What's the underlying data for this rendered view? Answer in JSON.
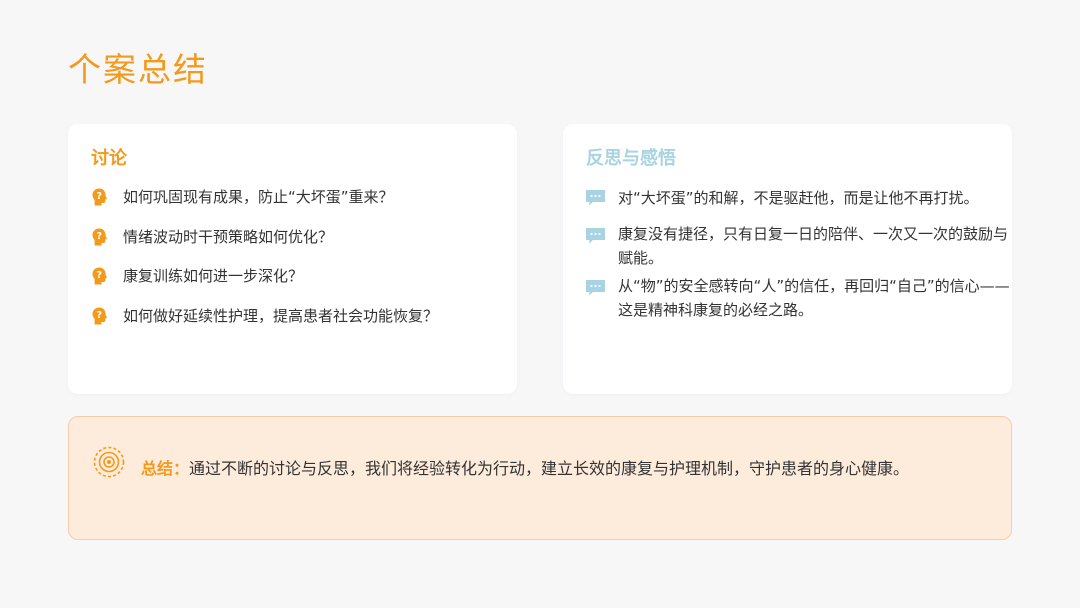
{
  "page": {
    "title": "个案总结"
  },
  "discussion": {
    "title": "讨论",
    "items": [
      "如何巩固现有成果，防止“大坏蛋”重来？",
      "情绪波动时干预策略如何优化？",
      "康复训练如何进一步深化？",
      "如何做好延续性护理，提高患者社会功能恢复？"
    ],
    "icon": "head-question-icon"
  },
  "reflection": {
    "title": "反思与感悟",
    "items": [
      "对“大坏蛋”的和解，不是驱赶他，而是让他不再打扰。",
      "康复没有捷径，只有日复一日的陪伴、一次又一次的鼓励与赋能。",
      "从“物”的安全感转向“人”的信任，再回归“自己”的信心——这是精神科康复的必经之路。"
    ],
    "icon": "speech-bubble-icon"
  },
  "summary": {
    "label": "总结：",
    "text": "通过不断的讨论与反思，我们将经验转化为行动，建立长效的康复与护理机制，守护患者的身心健康。",
    "icon": "target-icon"
  },
  "colors": {
    "accent": "#f39a1b",
    "secondary": "#a8d3e2",
    "summary_bg": "#fdebdc",
    "summary_border": "#f6ccaa"
  }
}
